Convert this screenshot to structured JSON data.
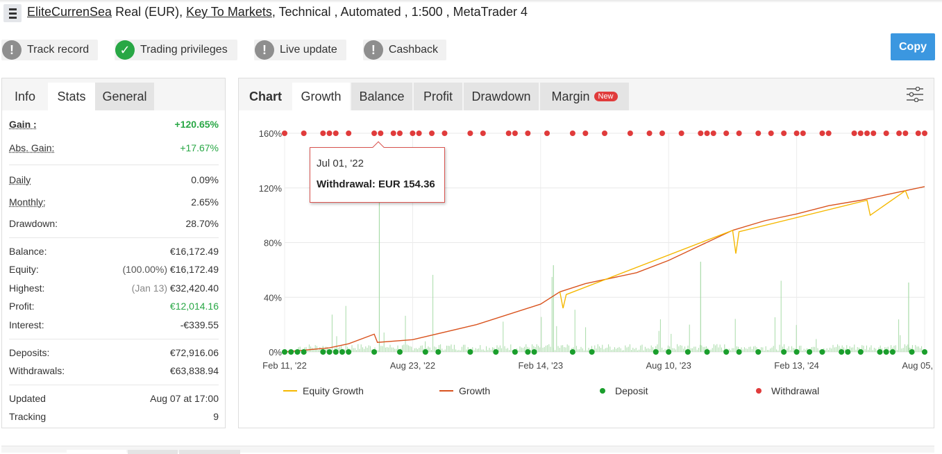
{
  "header": {
    "account_name": "EliteCurrenSea",
    "type": "Real (EUR),",
    "broker": "Key To Markets",
    "tail": ", Technical , Automated , 1:500 , MetaTrader 4"
  },
  "badges": [
    {
      "label": "Track record",
      "status": "warning"
    },
    {
      "label": "Trading privileges",
      "status": "ok"
    },
    {
      "label": "Live update",
      "status": "warning"
    },
    {
      "label": "Cashback",
      "status": "warning"
    }
  ],
  "copy_label": "Copy",
  "left_tabs": [
    "Info",
    "Stats",
    "General"
  ],
  "stats": {
    "gain": {
      "label": "Gain :",
      "value": "+120.65%"
    },
    "abs_gain": {
      "label": "Abs. Gain:",
      "value": "+17.67%"
    },
    "daily": {
      "label": "Daily",
      "value": "0.09%"
    },
    "monthly": {
      "label": "Monthly:",
      "value": "2.65%"
    },
    "drawdown": {
      "label": "Drawdown:",
      "value": "28.70%"
    },
    "balance": {
      "label": "Balance:",
      "value": "€16,172.49"
    },
    "equity": {
      "label": "Equity:",
      "pct": "(100.00%)",
      "value": "€16,172.49"
    },
    "highest": {
      "label": "Highest:",
      "date": "(Jan 13)",
      "value": "€32,420.40"
    },
    "profit": {
      "label": "Profit:",
      "value": "€12,014.16"
    },
    "interest": {
      "label": "Interest:",
      "value": "-€339.55"
    },
    "deposits": {
      "label": "Deposits:",
      "value": "€72,916.06"
    },
    "withdrawals": {
      "label": "Withdrawals:",
      "value": "€63,838.94"
    },
    "updated": {
      "label": "Updated",
      "value": "Aug 07 at 17:00"
    },
    "tracking": {
      "label": "Tracking",
      "value": "9"
    }
  },
  "chart_tabs": {
    "title": "Chart",
    "tabs": [
      "Growth",
      "Balance",
      "Profit",
      "Drawdown",
      "Margin"
    ],
    "active": "Growth",
    "new_badge": "New"
  },
  "tooltip": {
    "date": "Jul 01, '22",
    "text": "Withdrawal: EUR 154.36"
  },
  "legend": [
    "Equity Growth",
    "Growth",
    "Deposit",
    "Withdrawal"
  ],
  "colors": {
    "equity_growth": "#f5b800",
    "growth": "#d9531e",
    "deposit": "#1a9e2c",
    "withdrawal": "#e03b3b",
    "volume": "#a8dba8",
    "accent": "#3b97e0"
  },
  "chart_data": {
    "type": "line",
    "y_ticks": [
      "0%",
      "40%",
      "80%",
      "120%",
      "160%"
    ],
    "ylim": [
      0,
      160
    ],
    "x_ticks": [
      "Feb 11, '22",
      "Aug 23, '22",
      "Feb 14, '23",
      "Aug 10, '23",
      "Feb 13, '24",
      "Aug 05, '24"
    ],
    "series": [
      {
        "name": "Growth",
        "x": [
          0,
          0.07,
          0.1,
          0.14,
          0.145,
          0.2,
          0.3,
          0.4,
          0.43,
          0.47,
          0.55,
          0.6,
          0.65,
          0.7,
          0.75,
          0.8,
          0.85,
          0.9,
          0.95,
          1.0
        ],
        "values": [
          0,
          3,
          6,
          13,
          7,
          9,
          20,
          35,
          44,
          50,
          58,
          67,
          78,
          89,
          96,
          101,
          107,
          111,
          116,
          121
        ]
      },
      {
        "name": "Equity Growth",
        "x": [
          0.43,
          0.435,
          0.44,
          0.7,
          0.705,
          0.71,
          0.91,
          0.915,
          0.97,
          0.975
        ],
        "values": [
          44,
          32,
          42,
          89,
          72,
          88,
          111,
          100,
          118,
          112
        ]
      }
    ],
    "deposit_x": [
      0.0,
      0.01,
      0.02,
      0.03,
      0.06,
      0.07,
      0.08,
      0.09,
      0.1,
      0.14,
      0.18,
      0.22,
      0.24,
      0.29,
      0.33,
      0.36,
      0.38,
      0.39,
      0.45,
      0.48,
      0.58,
      0.6,
      0.63,
      0.66,
      0.69,
      0.71,
      0.74,
      0.78,
      0.8,
      0.82,
      0.84,
      0.87,
      0.88,
      0.9,
      0.93,
      0.94,
      0.95,
      0.98,
      1.0
    ],
    "withdrawal_x": [
      0.0,
      0.03,
      0.06,
      0.07,
      0.08,
      0.1,
      0.14,
      0.15,
      0.17,
      0.18,
      0.2,
      0.21,
      0.23,
      0.25,
      0.29,
      0.31,
      0.35,
      0.36,
      0.38,
      0.41,
      0.45,
      0.47,
      0.5,
      0.54,
      0.57,
      0.59,
      0.62,
      0.65,
      0.66,
      0.67,
      0.69,
      0.71,
      0.74,
      0.76,
      0.78,
      0.8,
      0.81,
      0.84,
      0.85,
      0.89,
      0.9,
      0.91,
      0.92,
      0.94,
      0.96,
      0.97,
      0.99,
      1.0
    ]
  }
}
